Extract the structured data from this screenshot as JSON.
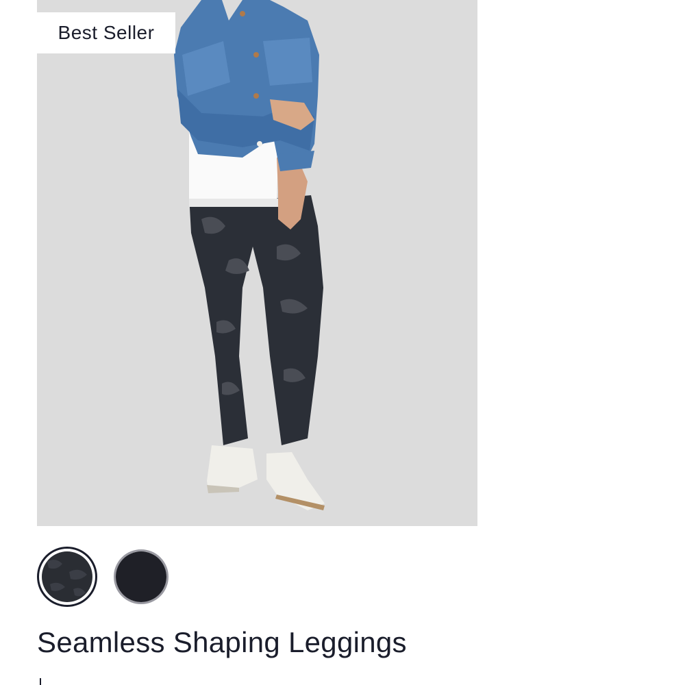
{
  "badge": {
    "label": "Best Seller"
  },
  "product": {
    "title": "Seamless Shaping Leggings"
  },
  "swatches": [
    {
      "name": "Black Camo",
      "color": "#2a2d33",
      "selected": true
    },
    {
      "name": "Black",
      "color": "#1f2027",
      "selected": false
    }
  ],
  "colors": {
    "image_background": "#dcdcdc",
    "text": "#1a1d2b"
  }
}
